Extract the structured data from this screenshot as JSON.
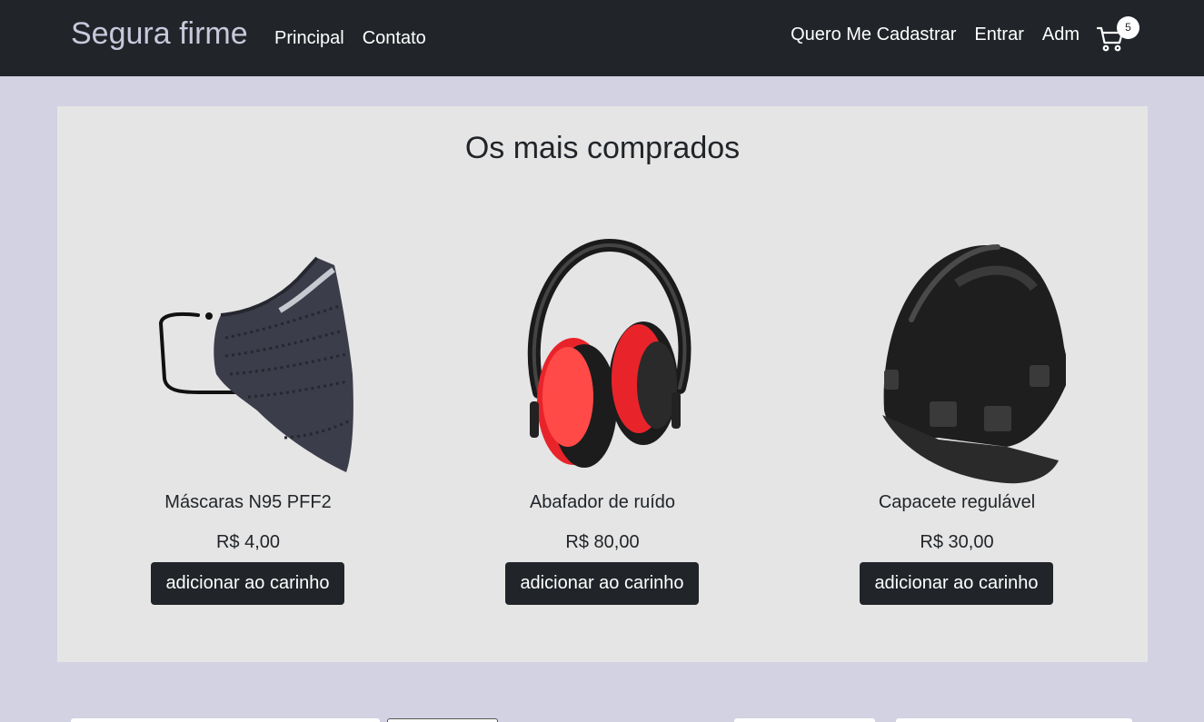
{
  "navbar": {
    "brand": "Segura firme",
    "links_left": [
      "Principal",
      "Contato"
    ],
    "links_right": [
      "Quero Me Cadastrar",
      "Entrar",
      "Adm"
    ],
    "cart_count": "5"
  },
  "main": {
    "title": "Os mais comprados",
    "products": [
      {
        "name": "Máscaras N95 PFF2",
        "price": "R$ 4,00",
        "button": "adicionar ao carinho",
        "icon": "n95-mask-image"
      },
      {
        "name": "Abafador de ruído",
        "price": "R$ 80,00",
        "button": "adicionar ao carinho",
        "icon": "ear-muffs-image"
      },
      {
        "name": "Capacete regulável",
        "price": "R$ 30,00",
        "button": "adicionar ao carinho",
        "icon": "helmet-image"
      }
    ]
  },
  "colors": {
    "navbar_bg": "#212529",
    "page_bg": "#d3d2e3",
    "panel_bg": "#e5e5e5",
    "button_bg": "#212529",
    "earmuff_red": "#e8242a"
  }
}
